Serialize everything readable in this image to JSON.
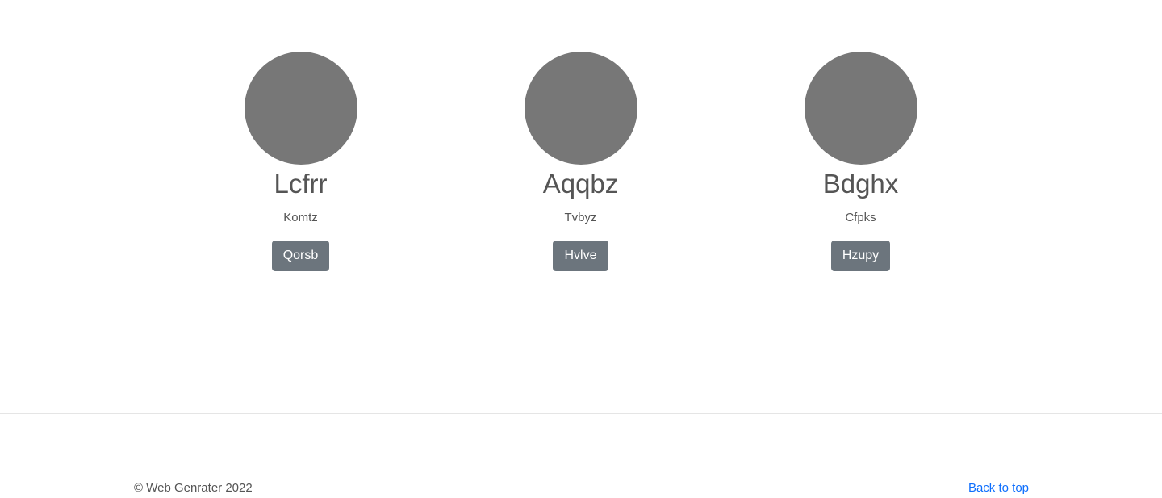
{
  "members": [
    {
      "name": "Lcfrr",
      "role": "Komtz",
      "button_label": "Qorsb"
    },
    {
      "name": "Aqqbz",
      "role": "Tvbyz",
      "button_label": "Hvlve"
    },
    {
      "name": "Bdghx",
      "role": "Cfpks",
      "button_label": "Hzupy"
    }
  ],
  "footer": {
    "copyright": "© Web Genrater 2022",
    "back_to_top": "Back to top"
  },
  "colors": {
    "avatar": "#777777",
    "button": "#6c757d",
    "link": "#0d6efd"
  }
}
